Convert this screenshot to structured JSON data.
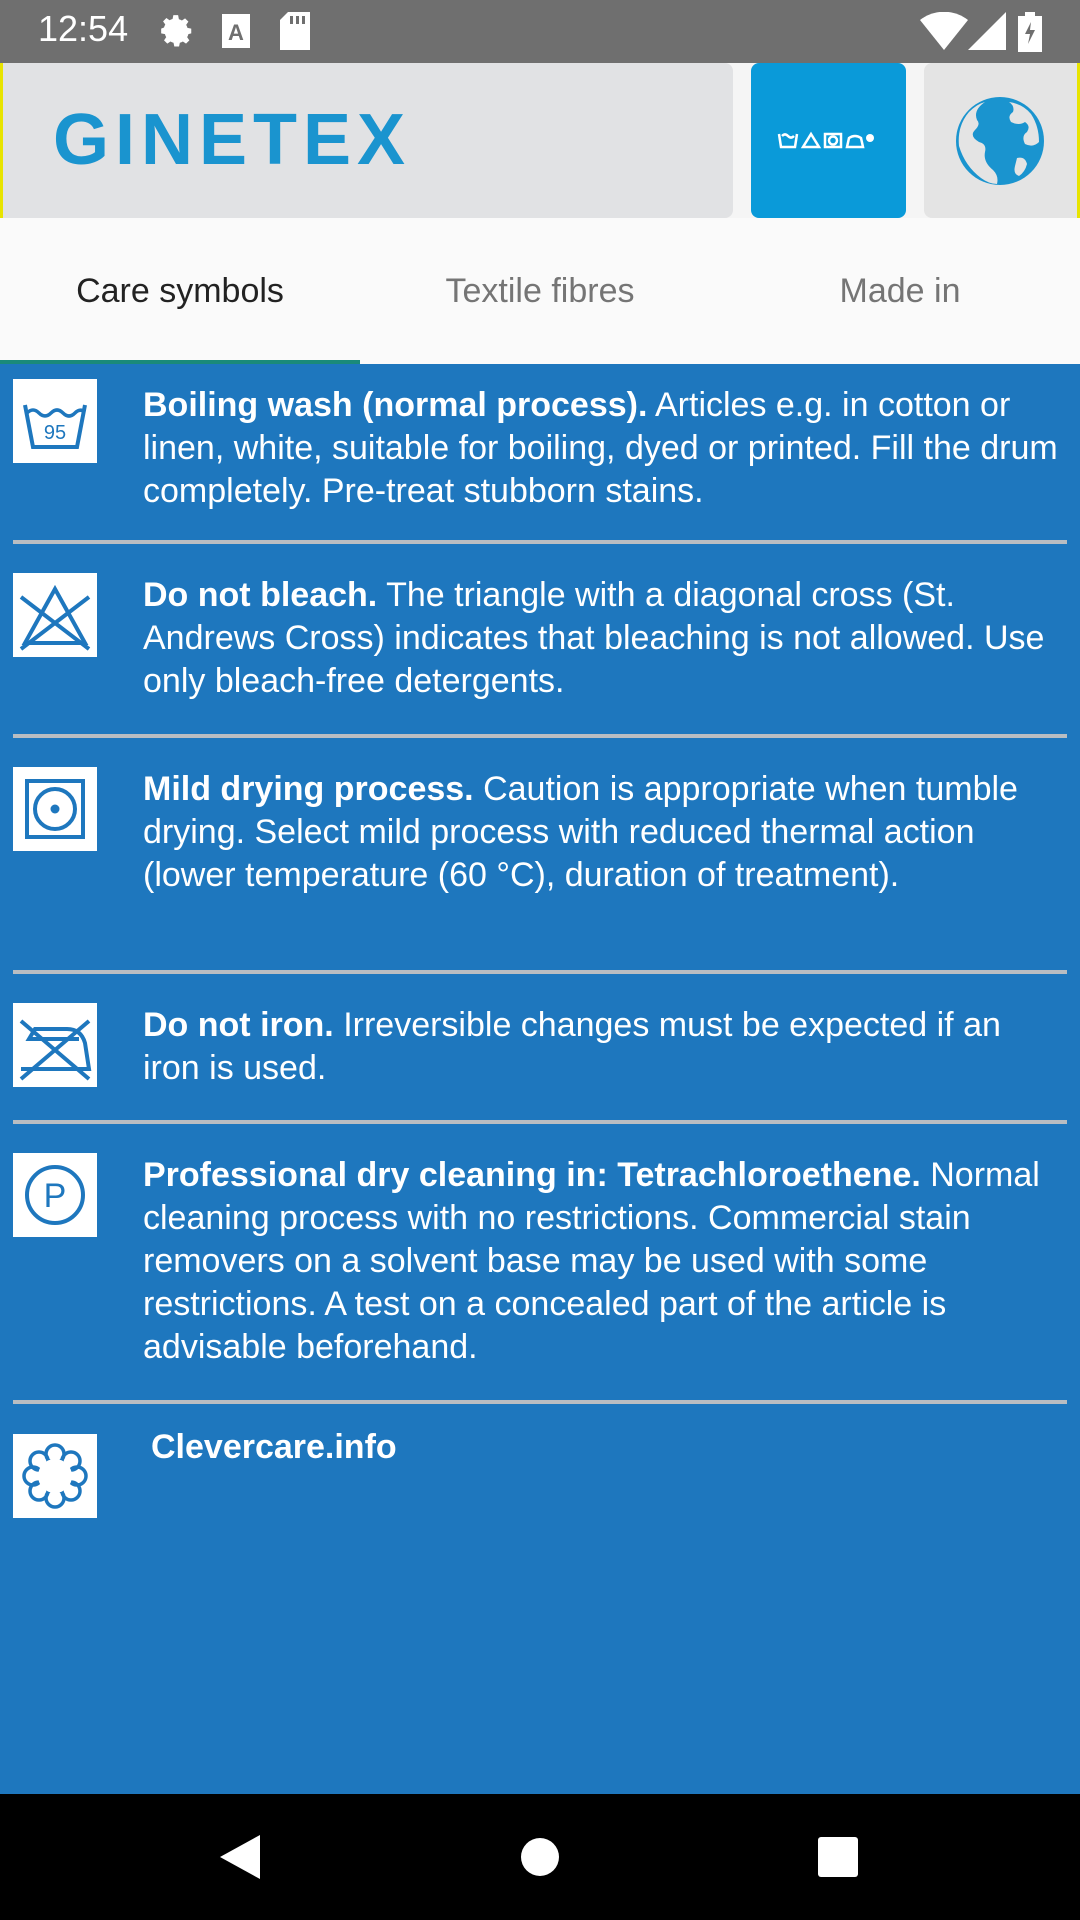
{
  "status_bar": {
    "time": "12:54",
    "icons": [
      "gear-icon",
      "keyboard-a-icon",
      "sd-card-icon",
      "wifi-icon",
      "signal-icon",
      "battery-icon"
    ]
  },
  "header": {
    "logo": "GINETEX",
    "buttons": [
      "care-symbols-button",
      "globe-icon"
    ]
  },
  "tabs": [
    {
      "label": "Care symbols",
      "active": true
    },
    {
      "label": "Textile fibres",
      "active": false
    },
    {
      "label": "Made in",
      "active": false
    }
  ],
  "items": [
    {
      "icon": "wash-95-icon",
      "icon_text": "95",
      "title": "Boiling wash (normal process).",
      "desc": " Articles e.g. in cotton or linen, white, suitable for boiling, dyed or printed. Fill the drum completely. Pre-treat stubborn stains."
    },
    {
      "icon": "do-not-bleach-icon",
      "title": "Do not bleach.",
      "desc": " The triangle with a diagonal cross (St. Andrews Cross) indicates that bleaching is not allowed. Use only bleach-free detergents."
    },
    {
      "icon": "tumble-dry-mild-icon",
      "title": "Mild drying process.",
      "desc": " Caution is appropriate when tumble drying. Select mild process with reduced thermal action (lower temperature (60 °C), duration of treatment)."
    },
    {
      "icon": "do-not-iron-icon",
      "title": "Do not iron.",
      "desc": " Irreversible changes must be expected if an iron is used."
    },
    {
      "icon": "dry-clean-p-icon",
      "icon_text": "P",
      "title": "Professional dry cleaning in: Tetrachloroethene.",
      "desc": " Normal cleaning process with no restrictions. Commercial stain removers on a solvent base may be used with some restrictions. A test on a concealed part of the article is advisable beforehand."
    },
    {
      "icon": "clevercare-icon",
      "title": "Clevercare.info",
      "desc": ""
    }
  ],
  "colors": {
    "content_bg": "#1e77be",
    "brand_blue": "#1a94cf",
    "tab_indicator": "#1a8a7a"
  },
  "nav_bar": [
    "back-icon",
    "home-icon",
    "recents-icon"
  ]
}
